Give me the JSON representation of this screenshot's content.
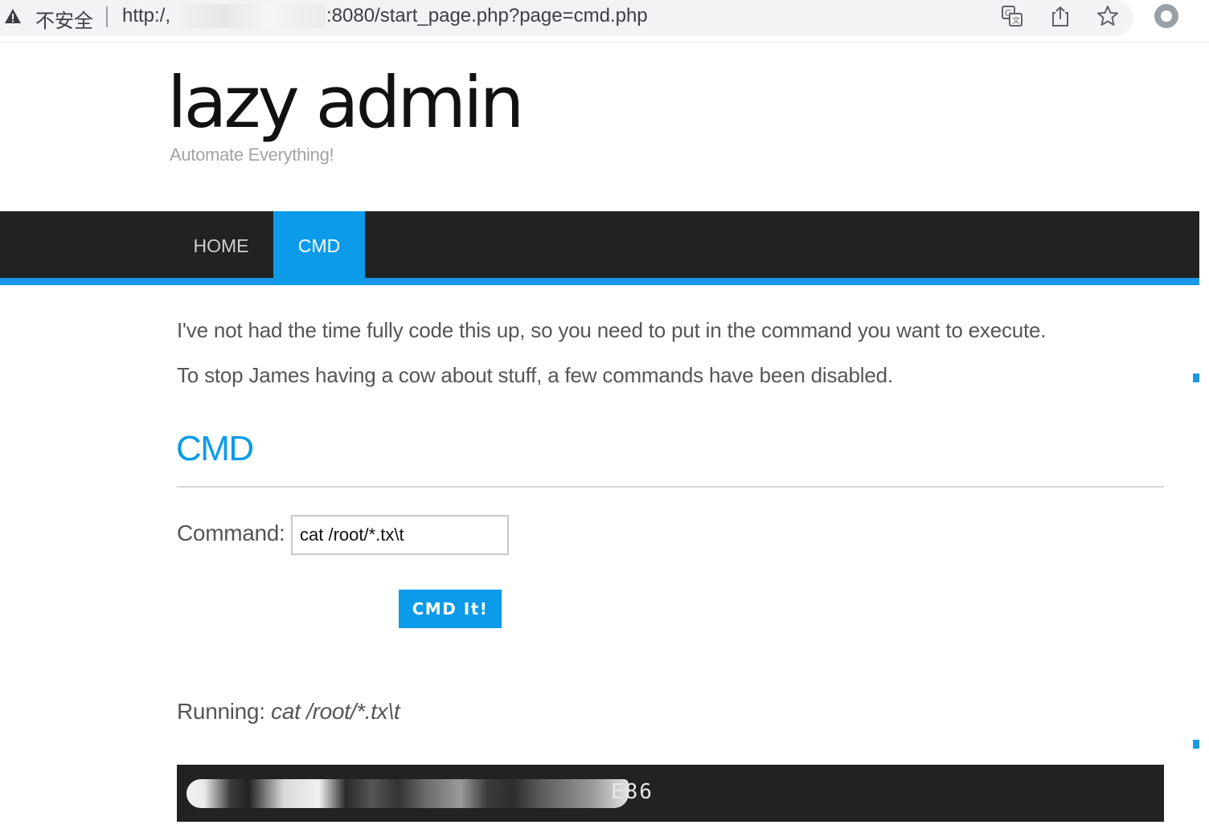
{
  "browser": {
    "security_label": "不安全",
    "url_prefix": "http:/,",
    "url_rest": ":8080/start_page.php?page=cmd.php",
    "icons": [
      "warning-icon",
      "translate-icon",
      "share-icon",
      "bookmark-star-icon",
      "profile-icon"
    ]
  },
  "site": {
    "title": "lazy admin",
    "tagline": "Automate Everything!"
  },
  "nav": {
    "items": [
      {
        "label": "HOME",
        "active": false
      },
      {
        "label": "CMD",
        "active": true
      }
    ]
  },
  "content": {
    "paragraph1": "I've not had the time fully code this up, so you need to put in the command you want to execute.",
    "paragraph2": "To stop James having a cow about stuff, a few commands have been disabled.",
    "section_title": "CMD",
    "command_label": "Command:",
    "command_value": "cat /root/*.tx\\t",
    "button_label": "CMD It!",
    "running_label": "Running:",
    "running_command": "cat /root/*.tx\\t",
    "output_visible_tail": "E86"
  },
  "colors": {
    "accent": "#0b9be9",
    "nav_bg": "#222222",
    "output_bg": "#222222",
    "text": "#555555"
  }
}
